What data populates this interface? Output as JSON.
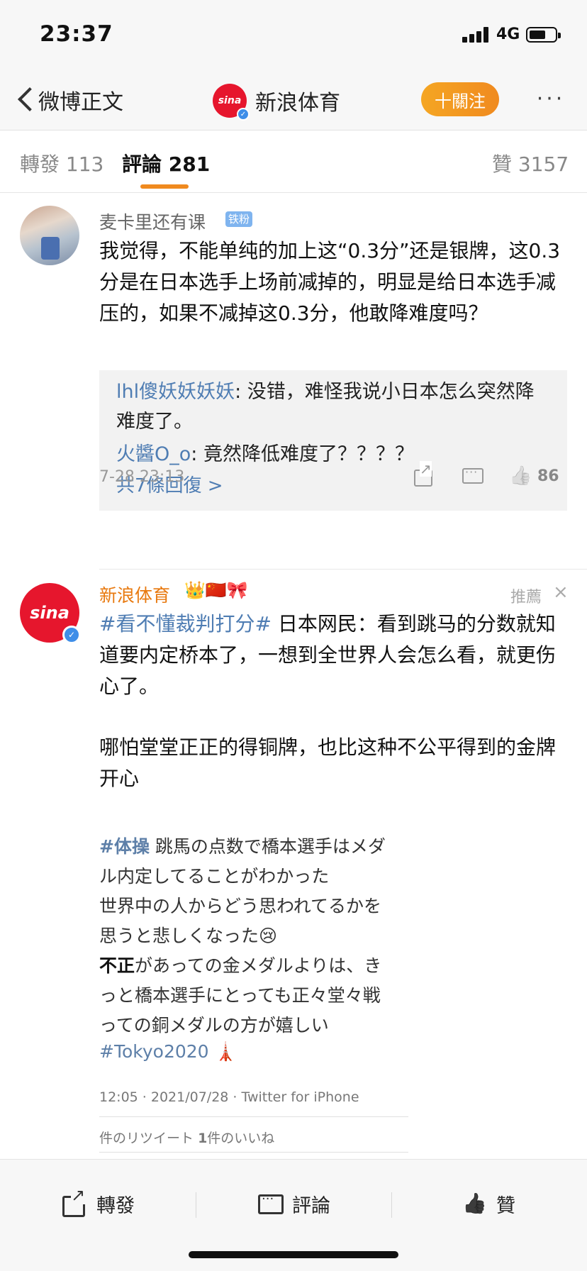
{
  "status": {
    "time": "23:37",
    "network": "4G"
  },
  "nav": {
    "back_label": "微博正文",
    "title": "新浪体育",
    "follow_label": "十關注",
    "more": "···"
  },
  "tabs": [
    {
      "label": "轉發",
      "count": "113"
    },
    {
      "label": "評論",
      "count": "281"
    },
    {
      "label": "贊",
      "count": "3157"
    }
  ],
  "comment1": {
    "username": "麦卡里还有课",
    "badge": "铁粉",
    "text": "我觉得，不能单纯的加上这“0.3分”还是银牌，这0.3分是在日本选手上场前减掉的，明显是给日本选手减压的，如果不减掉这0.3分，他敢降难度吗？",
    "replies": [
      {
        "name": "lhl傻妖妖妖妖",
        "text": ": 没错，难怪我说小日本怎么突然降难度了。"
      },
      {
        "name": "火醬O_o",
        "text": ": 竟然降低难度了？？？？"
      }
    ],
    "more_replies": "共7條回復 >",
    "timestamp": "7-28 23:13",
    "likes": "86"
  },
  "comment2": {
    "username": "新浪体育",
    "emojis": "👑🇨🇳🎀",
    "recommend_label": "推薦",
    "close_symbol": "×",
    "hashtag": "#看不懂裁判打分#",
    "text_after_hashtag": " 日本网民：看到跳马的分数就知道要内定桥本了，一想到全世界人会怎么看，就更伤心了。",
    "text2": "哪怕堂堂正正的得铜牌，也比这种不公平得到的金牌开心",
    "image": {
      "line1_tag": "#体操",
      "line1": "  跳馬の点数で橋本選手はメダ",
      "line2": "ル内定してることがわかった",
      "line3": "世界中の人からどう思われてるかを",
      "line4": "思うと悲しくなった😢",
      "line5_bold": "不正",
      "line5": "があっての金メダルよりは、き",
      "line6": "っと橋本選手にとっても正々堂々戦",
      "line7": "っての銅メダルの方が嬉しい",
      "line8": "#Tokyo2020 🗼",
      "tweet_meta": "12:05 · 2021/07/28 · Twitter for iPhone",
      "retweet_meta_a": "件のリツイート",
      "retweet_meta_b": "1",
      "retweet_meta_c": "件のいいね"
    }
  },
  "bottom": {
    "share": "轉發",
    "comment": "評論",
    "like": "贊"
  },
  "colors": {
    "accent": "#f08a1f",
    "link": "#4f7db3",
    "sina_red": "#e6162d",
    "verified_blue": "#3f8ee8"
  }
}
